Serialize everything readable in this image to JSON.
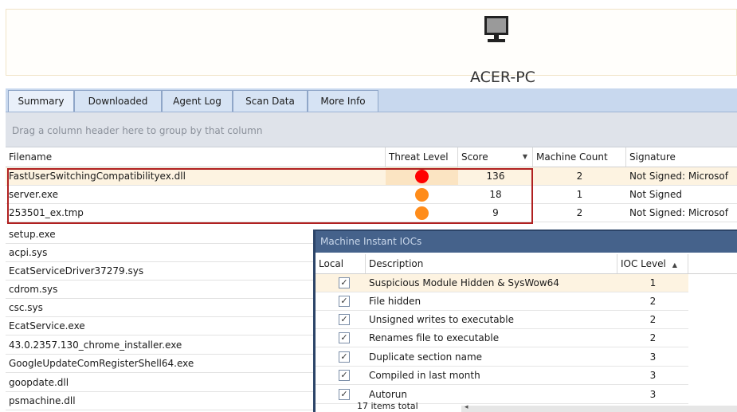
{
  "machine": {
    "name": "ACER-PC",
    "icon": "monitor-icon"
  },
  "tabs": [
    {
      "label": "Summary",
      "active": true
    },
    {
      "label": "Downloaded",
      "active": false
    },
    {
      "label": "Agent Log",
      "active": false
    },
    {
      "label": "Scan Data",
      "active": false
    },
    {
      "label": "More Info",
      "active": false
    }
  ],
  "group_hint": "Drag a column header here to group by that column",
  "grid": {
    "columns": [
      "Filename",
      "Threat Level",
      "Score",
      "Machine Count",
      "Signature"
    ],
    "sort_column": "Score",
    "rows": [
      {
        "filename": "FastUserSwitchingCompatibilityex.dll",
        "threat": "#ff0000",
        "score": "136",
        "count": "2",
        "signature": "Not Signed: Microsof"
      },
      {
        "filename": "server.exe",
        "threat": "#ff8c1a",
        "score": "18",
        "count": "1",
        "signature": "Not Signed"
      },
      {
        "filename": "253501_ex.tmp",
        "threat": "#ff8c1a",
        "score": "9",
        "count": "2",
        "signature": "Not Signed: Microsof"
      },
      {
        "filename": "setup.exe"
      },
      {
        "filename": "acpi.sys"
      },
      {
        "filename": "EcatServiceDriver37279.sys"
      },
      {
        "filename": "cdrom.sys"
      },
      {
        "filename": "csc.sys"
      },
      {
        "filename": "EcatService.exe"
      },
      {
        "filename": "43.0.2357.130_chrome_installer.exe"
      },
      {
        "filename": "GoogleUpdateComRegisterShell64.exe"
      },
      {
        "filename": "goopdate.dll"
      },
      {
        "filename": "psmachine.dll"
      }
    ]
  },
  "ioc_panel": {
    "title": "Machine Instant IOCs",
    "columns": [
      "Local",
      "Description",
      "IOC Level"
    ],
    "rows": [
      {
        "description": "Suspicious Module Hidden & SysWow64",
        "level": "1"
      },
      {
        "description": "File hidden",
        "level": "2"
      },
      {
        "description": "Unsigned writes to executable",
        "level": "2"
      },
      {
        "description": "Renames file to executable",
        "level": "2"
      },
      {
        "description": "Duplicate section name",
        "level": "3"
      },
      {
        "description": "Compiled in last month",
        "level": "3"
      },
      {
        "description": "Autorun",
        "level": "3"
      }
    ],
    "footer": "17 items total"
  },
  "colors": {
    "red_threat": "#ff0000",
    "orange_threat": "#ff8c1a",
    "highlight_border": "#b02020"
  }
}
